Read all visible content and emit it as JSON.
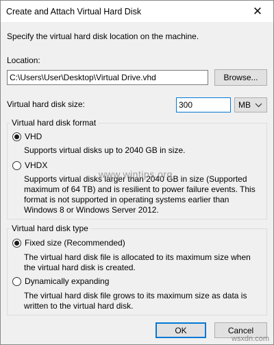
{
  "window": {
    "title": "Create and Attach Virtual Hard Disk",
    "close_glyph": "✕"
  },
  "instructions": "Specify the virtual hard disk location on the machine.",
  "location": {
    "label": "Location:",
    "value": "C:\\Users\\User\\Desktop\\Virtual Drive.vhd",
    "browse_label": "Browse..."
  },
  "size": {
    "label": "Virtual hard disk size:",
    "value": "300",
    "unit": "MB"
  },
  "format": {
    "legend": "Virtual hard disk format",
    "options": [
      {
        "label": "VHD",
        "selected": true,
        "description": "Supports virtual disks up to 2040 GB in size."
      },
      {
        "label": "VHDX",
        "selected": false,
        "description": "Supports virtual disks larger than 2040 GB in size (Supported maximum of 64 TB) and is resilient to power failure events. This format is not supported in operating systems earlier than Windows 8 or Windows Server 2012."
      }
    ]
  },
  "type": {
    "legend": "Virtual hard disk type",
    "options": [
      {
        "label": "Fixed size (Recommended)",
        "selected": true,
        "description": "The virtual hard disk file is allocated to its maximum size when the virtual hard disk is created."
      },
      {
        "label": "Dynamically expanding",
        "selected": false,
        "description": "The virtual hard disk file grows to its maximum size as data is written to the virtual hard disk."
      }
    ]
  },
  "buttons": {
    "ok": "OK",
    "cancel": "Cancel"
  },
  "watermarks": {
    "center": "www.wintips.org",
    "corner": "wsxdn.com"
  }
}
